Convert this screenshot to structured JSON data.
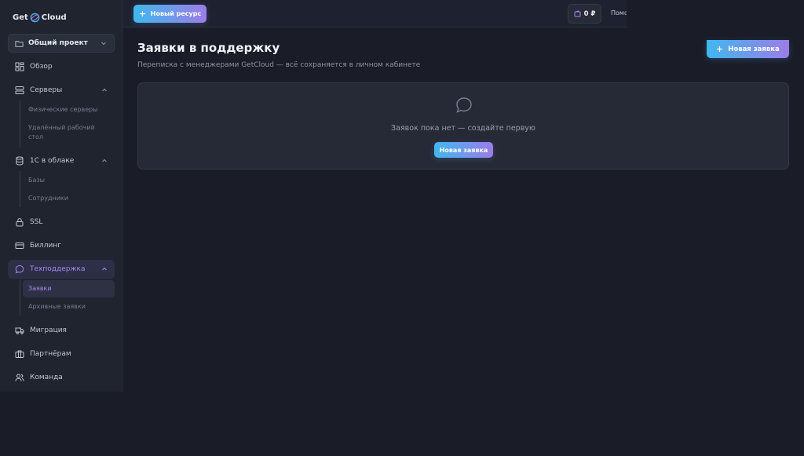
{
  "logo": {
    "part1": "Get",
    "part2": "Cloud"
  },
  "project": {
    "label": "Общий проект"
  },
  "nav": {
    "overview": "Обзор",
    "servers": "Серверы",
    "servers_sub": [
      "Физические серверы",
      "Удалённый рабочий",
      "стол"
    ],
    "one_c": "1С в облаке",
    "one_c_sub": [
      "Базы",
      "Сотрудники"
    ],
    "ssl": "SSL",
    "billing": "Биллинг",
    "support": "Техподдержка",
    "support_sub": [
      "Заявки",
      "Архивные заявки"
    ],
    "migration": "Миграция",
    "partners": "Партнёрам",
    "team": "Команда"
  },
  "topbar": {
    "new_resource": "Новый ресурс",
    "balance": "0 ₽",
    "help": "Помо"
  },
  "page": {
    "title": "Заявки в поддержку",
    "subtitle": "Переписка с менеджерами GetCloud — всё сохраняется в личном кабинете",
    "new_ticket_button": "Новая заявка"
  },
  "empty_state": {
    "message": "Заявок пока нет — создайте первую",
    "button": "Новая заявка"
  },
  "colors": {
    "accent_purple": "#a985f2",
    "gradient_start": "#40b8ee",
    "gradient_end": "#9c7ce8",
    "background": "#1a1d28"
  }
}
